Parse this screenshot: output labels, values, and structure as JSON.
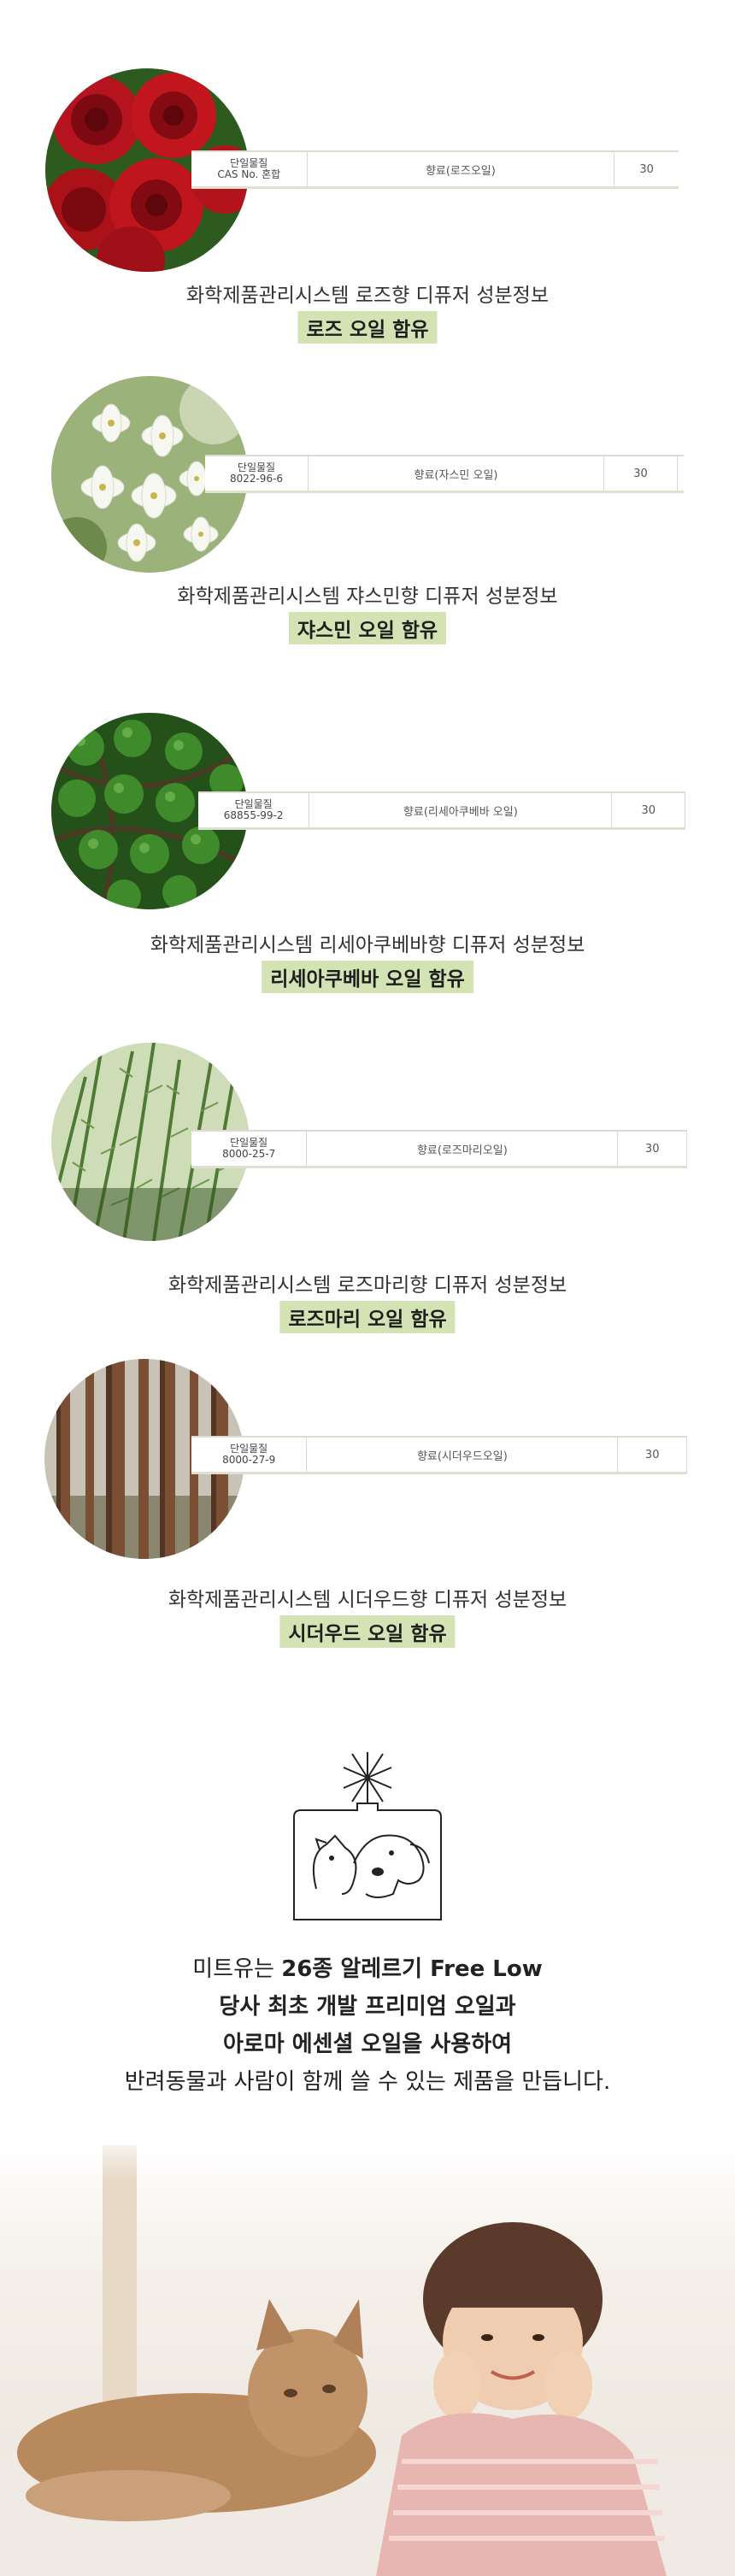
{
  "products": [
    {
      "id": "rose",
      "cas_label": "단일물질",
      "cas_value": "CAS No. 혼합",
      "component": "향료(로즈오일)",
      "amount": "30",
      "caption": "화학제품관리시스템 로즈향 디퓨저 성분정보",
      "highlight": "로즈 오일 함유",
      "colors": {
        "main": "#b5141e",
        "dark": "#5d060b",
        "bg": "#2d5a1f"
      }
    },
    {
      "id": "jasmine",
      "cas_label": "단일물질",
      "cas_value": "8022-96-6",
      "component": "향료(자스민 오일)",
      "amount": "30",
      "caption": "화학제품관리시스템 쟈스민향 디퓨저 성분정보",
      "highlight": "쟈스민 오일 함유",
      "colors": {
        "main": "#f7f7f2",
        "dark": "#a2ad85",
        "bg": "#7f9a5e"
      }
    },
    {
      "id": "litsea",
      "cas_label": "단일물질",
      "cas_value": "68855-99-2",
      "component": "향료(리세아쿠베바 오일)",
      "amount": "30",
      "caption": "화학제품관리시스템 리세아쿠베바향 디퓨저 성분정보",
      "highlight": "리세아쿠베바 오일 함유",
      "colors": {
        "main": "#3f8a2b",
        "dark": "#173a12",
        "bg": "#24501a"
      }
    },
    {
      "id": "rosemary",
      "cas_label": "단일물질",
      "cas_value": "8000-25-7",
      "component": "향료(로즈마리오일)",
      "amount": "30",
      "caption": "화학제품관리시스템 로즈마리향 디퓨저 성분정보",
      "highlight": "로즈마리 오일 함유",
      "colors": {
        "main": "#6b9a4a",
        "dark": "#2f4f20",
        "bg": "#cfdcb8"
      }
    },
    {
      "id": "cedarwood",
      "cas_label": "단일물질",
      "cas_value": "8000-27-9",
      "component": "향료(시더우드오일)",
      "amount": "30",
      "caption": "화학제품관리시스템 시더우드향 디퓨저 성분정보",
      "highlight": "시더우드 오일 함유",
      "colors": {
        "main": "#7a4f34",
        "dark": "#3b2418",
        "bg": "#c8c3b6"
      }
    }
  ],
  "promo": {
    "line1_pre": "미트유는 ",
    "line1_bold": "26종 알레르기 Free Low",
    "line2": "당사 최초 개발 프리미엄 오일과",
    "line3": "아로마 에센셜 오일을 사용하여",
    "line4": "반려동물과 사람이 함께 쓸 수 있는 제품을 만듭니다."
  },
  "icon": {
    "name": "diffuser-pet-icon",
    "stroke": "#222222"
  },
  "photo": {
    "name": "child-with-cat-photo",
    "colors": {
      "floor": "#eeeae4",
      "cat": "#b9895e",
      "shirt": "#e8b6b0",
      "hair": "#5a3a2a"
    }
  }
}
